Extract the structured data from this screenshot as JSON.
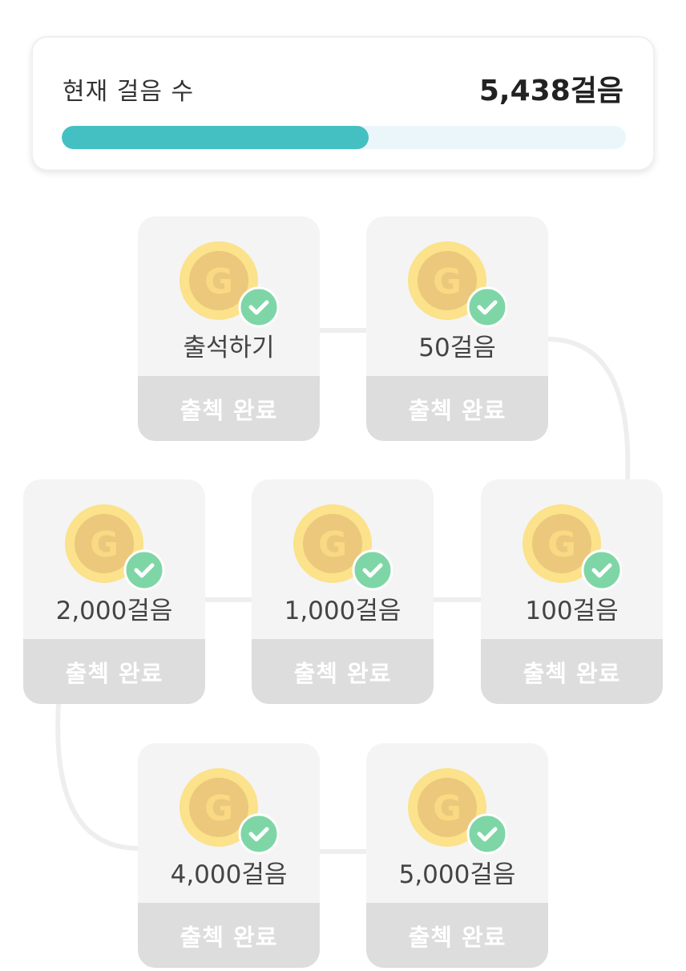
{
  "steps_card": {
    "label": "현재 걸음 수",
    "value": "5,438걸음",
    "progress_fraction": 0.544
  },
  "colors": {
    "accent": "#45c0c2",
    "track": "#eaf6f9",
    "check_badge": "#7ed6a6",
    "coin_outer": "#fbe28b",
    "coin_inner": "#ebc87c",
    "card_bg": "#f4f4f4",
    "status_bg": "#dddddd"
  },
  "rewards": [
    {
      "label": "출석하기",
      "status": "출첵 완료",
      "icon": "coin-g-icon",
      "badge": "check-icon"
    },
    {
      "label": "50걸음",
      "status": "출첵 완료",
      "icon": "coin-g-icon",
      "badge": "check-icon"
    },
    {
      "label": "100걸음",
      "status": "출첵 완료",
      "icon": "coin-g-icon",
      "badge": "check-icon"
    },
    {
      "label": "1,000걸음",
      "status": "출첵 완료",
      "icon": "coin-g-icon",
      "badge": "check-icon"
    },
    {
      "label": "2,000걸음",
      "status": "출첵 완료",
      "icon": "coin-g-icon",
      "badge": "check-icon"
    },
    {
      "label": "4,000걸음",
      "status": "출첵 완료",
      "icon": "coin-g-icon",
      "badge": "check-icon"
    },
    {
      "label": "5,000걸음",
      "status": "출첵 완료",
      "icon": "coin-g-icon",
      "badge": "check-icon"
    }
  ]
}
